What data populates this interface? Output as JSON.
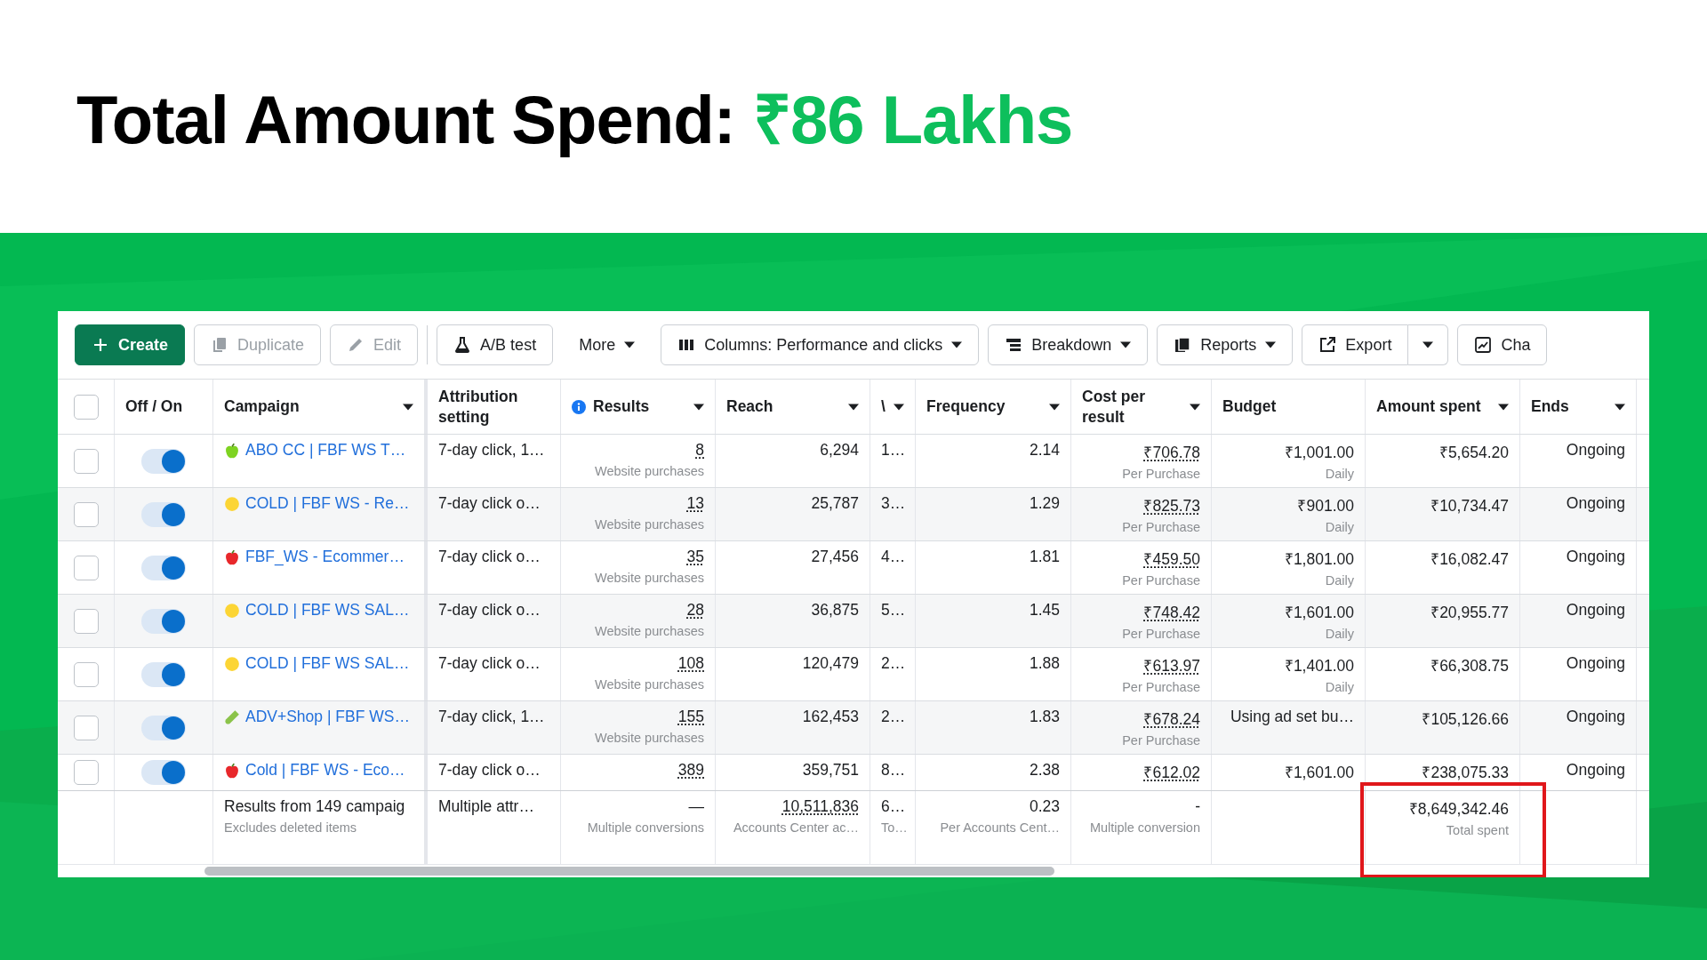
{
  "headline": {
    "text": "Total Amount Spend:",
    "highlight": "₹86 Lakhs"
  },
  "toolbar": [
    {
      "label": "Create",
      "kind": "primary",
      "caret": false
    },
    {
      "label": "Duplicate",
      "kind": "disabled",
      "caret": false
    },
    {
      "label": "Edit",
      "kind": "disabled",
      "caret": false
    },
    {
      "label": "A/B test",
      "kind": "outline",
      "caret": false
    },
    {
      "label": "More",
      "kind": "plain",
      "caret": true
    },
    {
      "label": "Columns: Performance and clicks",
      "kind": "outline",
      "caret": true
    },
    {
      "label": "Breakdown",
      "kind": "outline",
      "caret": true
    },
    {
      "label": "Reports",
      "kind": "outline",
      "caret": true
    },
    {
      "label": "Export",
      "kind": "split",
      "caret": true
    },
    {
      "label": "Cha",
      "kind": "outline",
      "caret": false
    }
  ],
  "header_checkbox": {
    "checked": false
  },
  "columns": [
    {
      "label": "Off / On",
      "sortable": false,
      "info": false
    },
    {
      "label": "Campaign",
      "sortable": true,
      "info": false
    },
    {
      "label": "Attribution setting",
      "sortable": false,
      "info": false
    },
    {
      "label": "Results",
      "sortable": true,
      "info": true
    },
    {
      "label": "Reach",
      "sortable": true,
      "info": false
    },
    {
      "label": "\\",
      "sortable": true,
      "info": false
    },
    {
      "label": "Frequency",
      "sortable": true,
      "info": false
    },
    {
      "label": "Cost per result",
      "sortable": true,
      "info": false
    },
    {
      "label": "Budget",
      "sortable": false,
      "info": false
    },
    {
      "label": "Amount spent",
      "sortable": true,
      "info": false
    },
    {
      "label": "Ends",
      "sortable": true,
      "info": false
    }
  ],
  "rows": [
    {
      "selected": false,
      "on": true,
      "kind": "apple",
      "color": "#7ed321",
      "campaign": "ABO CC | FBF WS T…",
      "attribution": "7-day click, 1…",
      "results": "8",
      "results_sub": "Website purchases",
      "reach": "6,294",
      "column_7": "1…",
      "frequency": "2.14",
      "cost": "₹706.78",
      "cost_sub": "Per Purchase",
      "budget": "₹1,001.00",
      "budget_sub": "Daily",
      "amount": "₹5,654.20",
      "ends": "Ongoing"
    },
    {
      "selected": false,
      "on": true,
      "kind": "dot",
      "color": "#fcd535",
      "campaign": "COLD | FBF WS - Re…",
      "attribution": "7-day click o…",
      "results": "13",
      "results_sub": "Website purchases",
      "reach": "25,787",
      "column_7": "3…",
      "frequency": "1.29",
      "cost": "₹825.73",
      "cost_sub": "Per Purchase",
      "budget": "₹901.00",
      "budget_sub": "Daily",
      "amount": "₹10,734.47",
      "ends": "Ongoing"
    },
    {
      "selected": false,
      "on": true,
      "kind": "apple",
      "color": "#e8282b",
      "campaign": "FBF_WS - Ecommer…",
      "attribution": "7-day click o…",
      "results": "35",
      "results_sub": "Website purchases",
      "reach": "27,456",
      "column_7": "4…",
      "frequency": "1.81",
      "cost": "₹459.50",
      "cost_sub": "Per Purchase",
      "budget": "₹1,801.00",
      "budget_sub": "Daily",
      "amount": "₹16,082.47",
      "ends": "Ongoing"
    },
    {
      "selected": false,
      "on": true,
      "kind": "dot",
      "color": "#fcd535",
      "campaign": "COLD | FBF WS SAL…",
      "attribution": "7-day click o…",
      "results": "28",
      "results_sub": "Website purchases",
      "reach": "36,875",
      "column_7": "5…",
      "frequency": "1.45",
      "cost": "₹748.42",
      "cost_sub": "Per Purchase",
      "budget": "₹1,601.00",
      "budget_sub": "Daily",
      "amount": "₹20,955.77",
      "ends": "Ongoing"
    },
    {
      "selected": false,
      "on": true,
      "kind": "dot",
      "color": "#fcd535",
      "campaign": "COLD | FBF WS SAL…",
      "attribution": "7-day click o…",
      "results": "108",
      "results_sub": "Website purchases",
      "reach": "120,479",
      "column_7": "2…",
      "frequency": "1.88",
      "cost": "₹613.97",
      "cost_sub": "Per Purchase",
      "budget": "₹1,401.00",
      "budget_sub": "Daily",
      "amount": "₹66,308.75",
      "ends": "Ongoing"
    },
    {
      "selected": false,
      "on": true,
      "kind": "tube",
      "color": "#8bc34a",
      "campaign": "ADV+Shop | FBF WS…",
      "attribution": "7-day click, 1…",
      "results": "155",
      "results_sub": "Website purchases",
      "reach": "162,453",
      "column_7": "2…",
      "frequency": "1.83",
      "cost": "₹678.24",
      "cost_sub": "Per Purchase",
      "budget": "Using ad set bu…",
      "amount": "₹105,126.66",
      "ends": "Ongoing"
    },
    {
      "selected": false,
      "on": true,
      "kind": "apple",
      "color": "#e8282b",
      "campaign": "Cold | FBF WS - Eco…",
      "attribution": "7-day click o…",
      "results": "389",
      "reach": "359,751",
      "column_7": "8…",
      "frequency": "2.38",
      "cost": "₹612.02",
      "budget": "₹1,601.00",
      "amount": "₹238,075.33",
      "ends": "Ongoing"
    }
  ],
  "totals": {
    "campaign": "Results from 149 campaig",
    "campaign_sub": "Excludes deleted items",
    "attribution": "Multiple attr…",
    "results": "—",
    "results_sub": "Multiple conversions",
    "reach": "10,511,836",
    "reach_sub": "Accounts Center ac…",
    "column_7": "6…",
    "column_7_sub": "To…",
    "frequency": "0.23",
    "frequency_sub": "Per Accounts Cent…",
    "cost": "-",
    "cost_sub": "Multiple conversion",
    "amount": "₹8,649,342.46",
    "amount_sub": "Total spent",
    "amount_highlighted": true
  }
}
